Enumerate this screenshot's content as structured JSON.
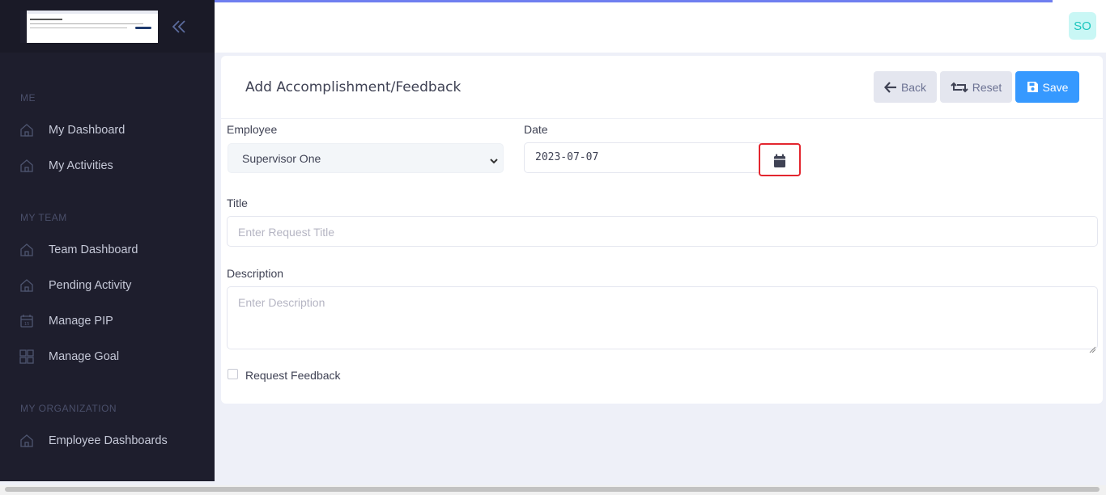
{
  "sidebar": {
    "sections": [
      {
        "title": "ME",
        "items": [
          {
            "label": "My Dashboard",
            "icon": "home-icon"
          },
          {
            "label": "My Activities",
            "icon": "home-icon"
          }
        ]
      },
      {
        "title": "MY TEAM",
        "items": [
          {
            "label": "Team Dashboard",
            "icon": "home-icon"
          },
          {
            "label": "Pending Activity",
            "icon": "home-icon"
          },
          {
            "label": "Manage PIP",
            "icon": "calendar-icon"
          },
          {
            "label": "Manage Goal",
            "icon": "grid-icon"
          }
        ]
      },
      {
        "title": "MY ORGANIZATION",
        "items": [
          {
            "label": "Employee Dashboards",
            "icon": "home-icon"
          }
        ]
      }
    ]
  },
  "header": {
    "avatar_initials": "SO",
    "progress_fraction": 0.94
  },
  "card": {
    "title": "Add Accomplishment/Feedback",
    "buttons": {
      "back": "Back",
      "reset": "Reset",
      "save": "Save"
    }
  },
  "form": {
    "employee_label": "Employee",
    "employee_value": "Supervisor One",
    "date_label": "Date",
    "date_value": "2023-07-07",
    "title_label": "Title",
    "title_placeholder": "Enter Request Title",
    "description_label": "Description",
    "description_placeholder": "Enter Description",
    "request_feedback_label": "Request Feedback",
    "request_feedback_checked": false
  },
  "colors": {
    "sidebar_bg": "#1e1e2d",
    "primary": "#3699ff",
    "highlight_border": "#e3262f",
    "avatar_bg": "#c9f7f5",
    "avatar_text": "#1bc5bd"
  }
}
